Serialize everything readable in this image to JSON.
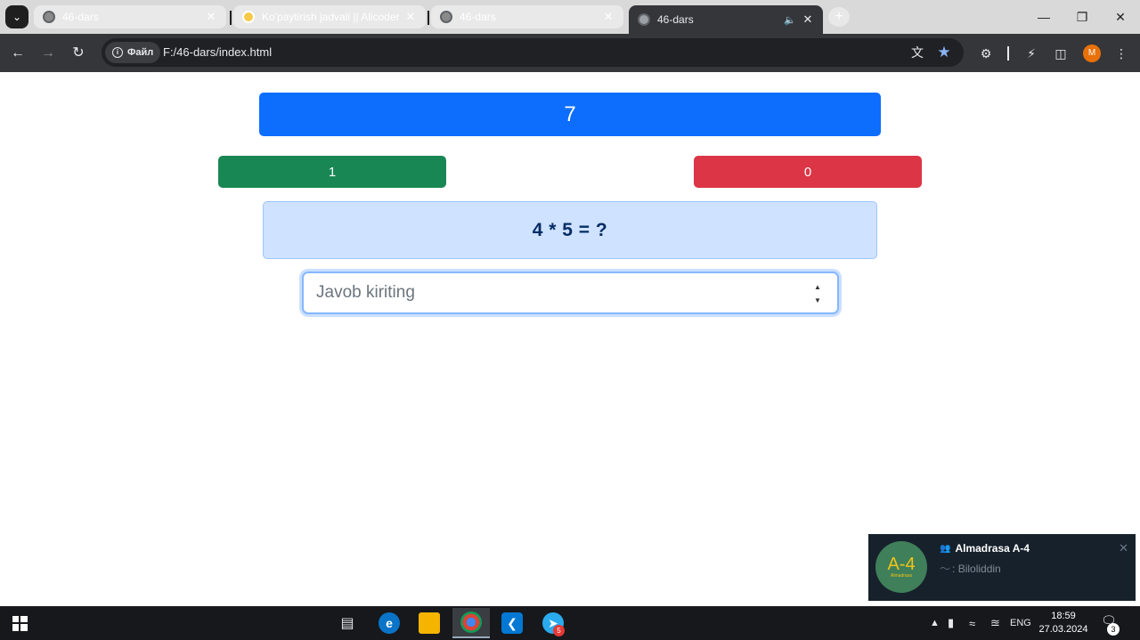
{
  "browser": {
    "tabs": [
      {
        "title": "46-dars",
        "favicon": "globe-icon",
        "active": false
      },
      {
        "title": "Ko'paytirish jadvali || Alicoder.uz",
        "favicon": "alicoder-icon",
        "active": false
      },
      {
        "title": "46-dars",
        "favicon": "globe-icon",
        "active": false
      },
      {
        "title": "46-dars",
        "favicon": "globe-icon",
        "active": true,
        "audio": true
      }
    ],
    "site_chip": "Файл",
    "url": "F:/46-dars/index.html",
    "profile_initial": "M"
  },
  "page": {
    "counter": "7",
    "correct_count": "1",
    "wrong_count": "0",
    "question": "4 * 5 = ?",
    "answer_placeholder": "Javob kiriting",
    "answer_value": ""
  },
  "notification": {
    "avatar_text": "A-4",
    "avatar_subtext": "Almadrasa",
    "title": "Almadrasa A-4",
    "sender": "Biloliddin"
  },
  "taskbar": {
    "apps": [
      "task-view",
      "edge",
      "file-explorer",
      "chrome",
      "vscode",
      "telegram"
    ],
    "telegram_badge": "5",
    "language": "ENG",
    "time": "18:59",
    "date": "27.03.2024",
    "notification_count": "3"
  },
  "colors": {
    "primary": "#0d6efd",
    "success": "#198754",
    "danger": "#dc3545",
    "alert_bg": "#cfe2ff",
    "alert_text": "#052c65"
  }
}
